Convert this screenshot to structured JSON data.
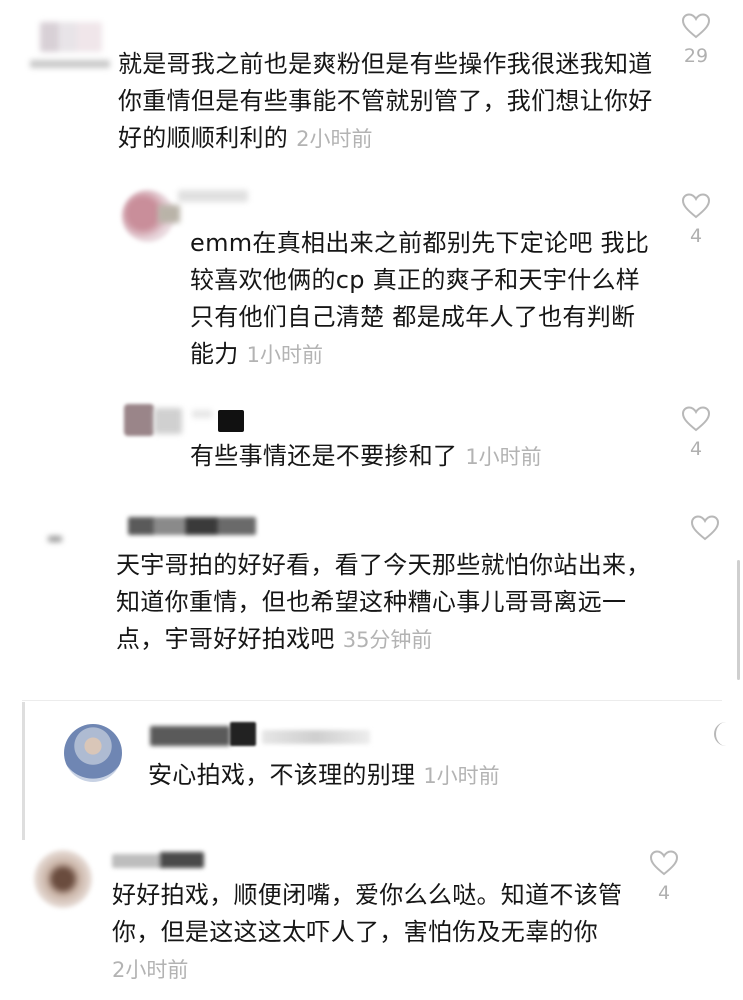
{
  "comments": [
    {
      "lines": [
        "就是哥我之前也是爽粉但是有些操作我很迷我知道",
        "你重情但是有些事能不管就别管了，我们想让你好",
        "好的顺顺利利的"
      ],
      "time": "2小时前",
      "likes": "29"
    },
    {
      "lines": [
        "emm在真相出来之前都别先下定论吧 我比",
        "较喜欢他俩的cp 真正的爽子和天宇什么样",
        "只有他们自己清楚 都是成年人了也有判断",
        "能力"
      ],
      "time": "1小时前",
      "likes": "4"
    },
    {
      "lines": [
        "有些事情还是不要掺和了"
      ],
      "time": "1小时前",
      "likes": "4"
    },
    {
      "lines": [
        "天宇哥拍的好好看，看了今天那些就怕你站出来，",
        "知道你重情，但也希望这种糟心事儿哥哥离远一",
        "点，宇哥好好拍戏吧"
      ],
      "time": "35分钟前",
      "likes": ""
    },
    {
      "lines": [
        "安心拍戏，不该理的别理"
      ],
      "time": "1小时前",
      "likes": ""
    },
    {
      "lines": [
        "好好拍戏，顺便闭嘴，爱你么么哒。知道不该管",
        "你，但是这这这太吓人了，害怕伤及无辜的你"
      ],
      "time": "2小时前",
      "likes": "4"
    }
  ],
  "colors": {
    "text": "#161616",
    "time": "#b3b3b3",
    "icon": "#b8b8b8"
  },
  "icons": {
    "like": "heart-outline-icon"
  }
}
